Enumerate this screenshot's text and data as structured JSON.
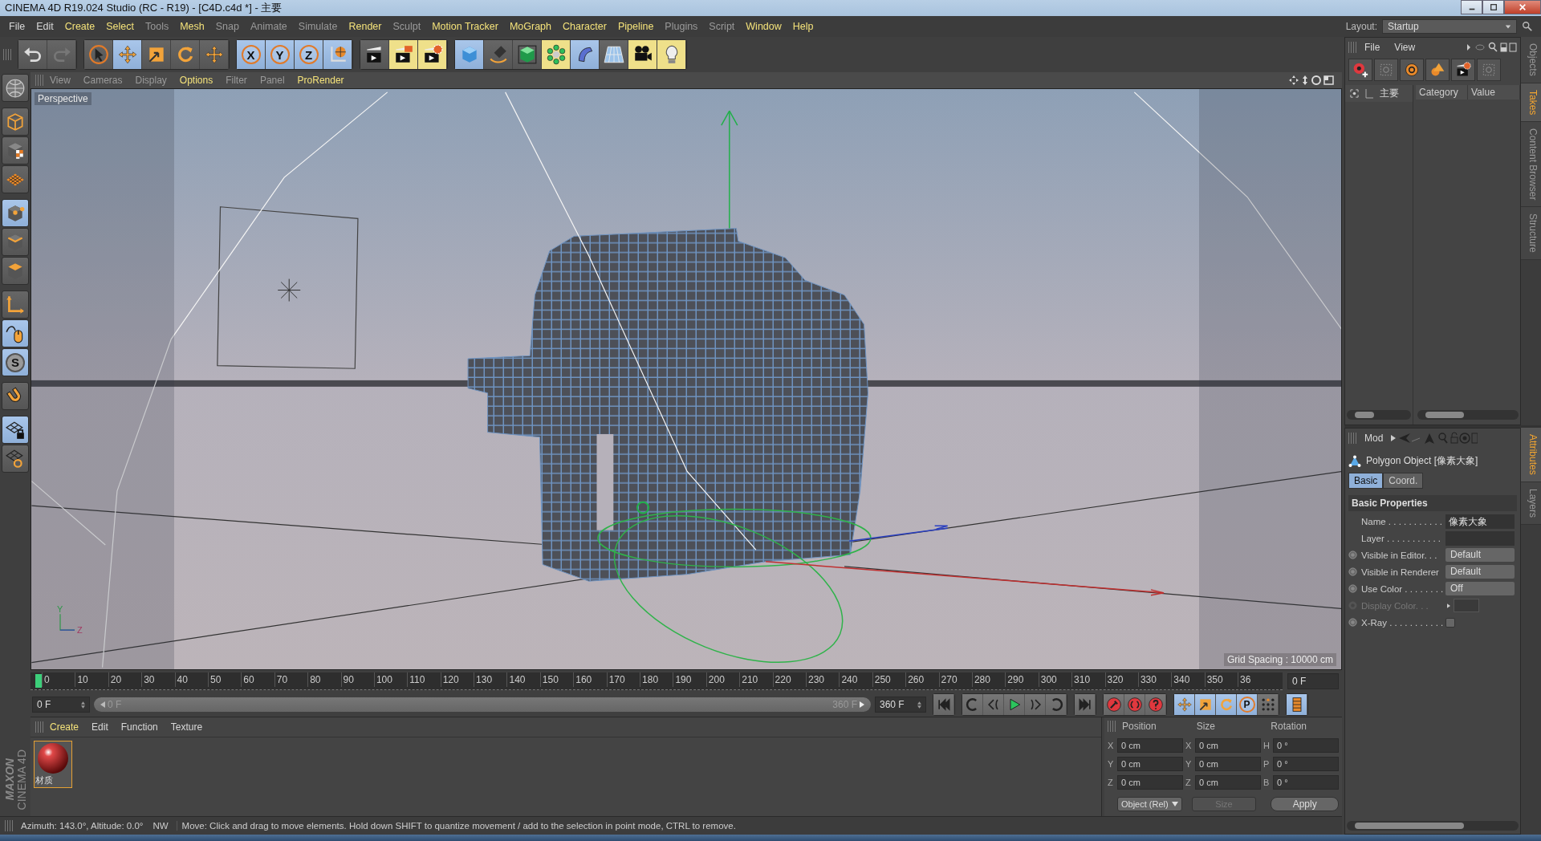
{
  "window": {
    "title": "CINEMA 4D R19.024 Studio (RC - R19) - [C4D.c4d *] - 主要"
  },
  "menu": [
    {
      "label": "File",
      "kind": "normal"
    },
    {
      "label": "Edit",
      "kind": "normal"
    },
    {
      "label": "Create",
      "kind": "accent"
    },
    {
      "label": "Select",
      "kind": "accent"
    },
    {
      "label": "Tools",
      "kind": "muted"
    },
    {
      "label": "Mesh",
      "kind": "accent"
    },
    {
      "label": "Snap",
      "kind": "muted"
    },
    {
      "label": "Animate",
      "kind": "muted"
    },
    {
      "label": "Simulate",
      "kind": "muted"
    },
    {
      "label": "Render",
      "kind": "accent"
    },
    {
      "label": "Sculpt",
      "kind": "muted"
    },
    {
      "label": "Motion Tracker",
      "kind": "accent"
    },
    {
      "label": "MoGraph",
      "kind": "accent"
    },
    {
      "label": "Character",
      "kind": "accent"
    },
    {
      "label": "Pipeline",
      "kind": "accent"
    },
    {
      "label": "Plugins",
      "kind": "muted"
    },
    {
      "label": "Script",
      "kind": "muted"
    },
    {
      "label": "Window",
      "kind": "accent"
    },
    {
      "label": "Help",
      "kind": "accent"
    }
  ],
  "layout": {
    "label": "Layout:",
    "value": "Startup"
  },
  "toolbar": [
    [
      {
        "selected": false
      },
      {
        "selected": false
      }
    ],
    [
      {
        "selected": false
      },
      {
        "selected": true
      },
      {
        "selected": false
      },
      {
        "selected": false
      },
      {
        "selected": false
      }
    ],
    [
      {
        "selected": true,
        "label": "X"
      },
      {
        "selected": true,
        "label": "Y"
      },
      {
        "selected": true,
        "label": "Z"
      },
      {
        "selected": true
      }
    ],
    [
      {
        "selected": false
      },
      {
        "selected": false
      },
      {
        "selected": false
      }
    ],
    [
      {
        "selected": true
      },
      {
        "selected": false
      },
      {
        "selected": false
      },
      {
        "selected": false
      },
      {
        "selected": true
      },
      {
        "selected": false
      },
      {
        "selected": false
      },
      {
        "selected": false
      }
    ]
  ],
  "left_tools": [
    {
      "selected": false
    },
    {
      "selected": false
    },
    {
      "selected": false
    },
    {
      "selected": false
    },
    {
      "selected": true
    },
    {
      "selected": false
    },
    {
      "selected": false
    },
    {
      "selected": false
    },
    {
      "selected": true
    },
    {
      "selected": true,
      "label": "S"
    },
    {
      "selected": false
    },
    {
      "selected": true
    },
    {
      "selected": false
    }
  ],
  "viewport": {
    "menu": [
      {
        "label": "View",
        "kind": "muted"
      },
      {
        "label": "Cameras",
        "kind": "muted"
      },
      {
        "label": "Display",
        "kind": "muted"
      },
      {
        "label": "Options",
        "kind": "accent"
      },
      {
        "label": "Filter",
        "kind": "muted"
      },
      {
        "label": "Panel",
        "kind": "muted"
      },
      {
        "label": "ProRender",
        "kind": "accent"
      }
    ],
    "camera": "Perspective",
    "grid_spacing": "Grid Spacing : 10000 cm",
    "gizmo": [
      "Y",
      "Z"
    ]
  },
  "timeline": {
    "ticks": [
      "0",
      "10",
      "20",
      "30",
      "40",
      "50",
      "60",
      "70",
      "80",
      "90",
      "100",
      "110",
      "120",
      "130",
      "140",
      "150",
      "160",
      "170",
      "180",
      "190",
      "200",
      "210",
      "220",
      "230",
      "240",
      "250",
      "260",
      "270",
      "280",
      "290",
      "300",
      "310",
      "320",
      "330",
      "340",
      "350",
      "36"
    ],
    "current_frame": "0 F"
  },
  "transport": {
    "start": "0 F",
    "range": {
      "start": "0 F",
      "end": "360 F",
      "level": 1
    },
    "end": "360 F",
    "groups": [
      [
        {
          "selected": false
        }
      ],
      [
        {
          "selected": false
        },
        {
          "selected": false
        },
        {
          "selected": false
        },
        {
          "selected": false
        },
        {
          "selected": false
        }
      ],
      [
        {
          "selected": false
        }
      ],
      [
        {
          "selected": false
        },
        {
          "selected": false
        },
        {
          "selected": false
        }
      ],
      [
        {
          "selected": true
        },
        {
          "selected": true
        },
        {
          "selected": true
        },
        {
          "selected": true,
          "label": "P"
        },
        {
          "selected": false
        }
      ],
      [
        {
          "selected": true
        }
      ]
    ]
  },
  "materials": {
    "menu": [
      {
        "label": "Create",
        "kind": "accent"
      },
      {
        "label": "Edit",
        "kind": "normal"
      },
      {
        "label": "Function",
        "kind": "normal"
      },
      {
        "label": "Texture",
        "kind": "normal"
      }
    ],
    "items": [
      {
        "name": "材质",
        "selected": true
      }
    ]
  },
  "coordinates": {
    "headers": [
      "Position",
      "Size",
      "Rotation"
    ],
    "rows": [
      {
        "p_axis": "X",
        "position": "0 cm",
        "s_axis": "X",
        "size": "0 cm",
        "r_axis": "H",
        "rotation": "0 °"
      },
      {
        "p_axis": "Y",
        "position": "0 cm",
        "s_axis": "Y",
        "size": "0 cm",
        "r_axis": "P",
        "rotation": "0 °"
      },
      {
        "p_axis": "Z",
        "position": "0 cm",
        "s_axis": "Z",
        "size": "0 cm",
        "r_axis": "B",
        "rotation": "0 °"
      }
    ],
    "mode": "Object (Rel)",
    "size_mode": "Size",
    "apply": "Apply"
  },
  "logo": {
    "brand": "MAXON",
    "product": "CINEMA 4D"
  },
  "status": {
    "view": "Azimuth: 143.0°, Altitude: 0.0°",
    "direction": "NW",
    "message": "Move: Click and drag to move elements. Hold down SHIFT to quantize movement / add to the selection in point mode, CTRL to remove."
  },
  "right_panel": {
    "menu": [
      "File",
      "View"
    ],
    "takes": {
      "root": "主要",
      "columns": [
        "Category",
        "Value"
      ]
    },
    "side_tabs": [
      {
        "label": "Objects",
        "selected": false
      },
      {
        "label": "Takes",
        "selected": true
      },
      {
        "label": "Content Browser",
        "selected": false
      },
      {
        "label": "Structure",
        "selected": false
      }
    ]
  },
  "attributes": {
    "mode": "Mod",
    "title": "Polygon Object [像素大象]",
    "tabs": [
      {
        "label": "Basic",
        "selected": true
      },
      {
        "label": "Coord.",
        "selected": false
      }
    ],
    "section": "Basic Properties",
    "properties": [
      {
        "label": "Name . . . . . . . . . . .",
        "kind": "text",
        "value": "像素大象",
        "keyframe": false,
        "disabled": false
      },
      {
        "label": "Layer . . . . . . . . . . .",
        "kind": "text",
        "keyframe": false,
        "disabled": false
      },
      {
        "label": "Visible in Editor. . .",
        "kind": "dropdown",
        "value": "Default",
        "keyframe": true,
        "disabled": false
      },
      {
        "label": "Visible in Renderer",
        "kind": "dropdown",
        "value": "Default",
        "keyframe": true,
        "disabled": false
      },
      {
        "label": "Use Color . . . . . . . .",
        "kind": "dropdown",
        "value": "Off",
        "keyframe": true,
        "disabled": false
      },
      {
        "label": "Display Color. . .",
        "kind": "color",
        "keyframe": true,
        "disabled": true
      },
      {
        "label": "X-Ray . . . . . . . . . . .",
        "kind": "checkbox",
        "checked": false,
        "keyframe": true,
        "disabled": false
      }
    ],
    "side_tabs": [
      {
        "label": "Attributes",
        "selected": true
      },
      {
        "label": "Layers",
        "selected": false
      }
    ]
  }
}
